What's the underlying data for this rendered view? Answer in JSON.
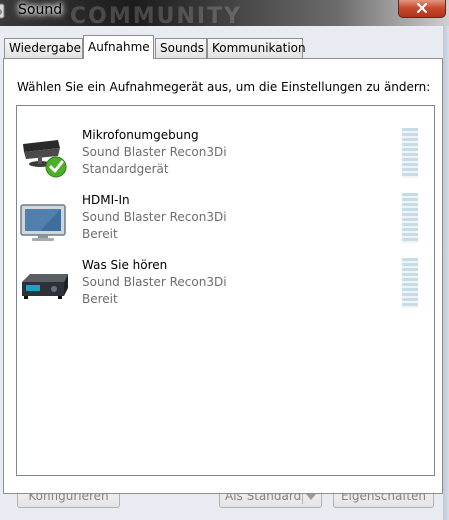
{
  "window": {
    "title": "Sound",
    "title_bar_background_text": "COMMUNITY"
  },
  "tabs": [
    {
      "label": "Wiedergabe",
      "active": false
    },
    {
      "label": "Aufnahme",
      "active": true
    },
    {
      "label": "Sounds",
      "active": false
    },
    {
      "label": "Kommunikation",
      "active": false
    }
  ],
  "panel": {
    "instruction": "Wählen Sie ein Aufnahmegerät aus, um die Einstellungen zu ändern:"
  },
  "devices": [
    {
      "name": "Mikrofonumgebung",
      "driver": "Sound Blaster Recon3Di",
      "status": "Standardgerät",
      "icon": "microphone-icon",
      "default": true
    },
    {
      "name": "HDMI-In",
      "driver": "Sound Blaster Recon3Di",
      "status": "Bereit",
      "icon": "monitor-icon",
      "default": false
    },
    {
      "name": "Was Sie hören",
      "driver": "Sound Blaster Recon3Di",
      "status": "Bereit",
      "icon": "receiver-icon",
      "default": false
    }
  ],
  "buttons": {
    "configure": "Konfigurieren",
    "set_default": "Als Standard",
    "properties": "Eigenschaften"
  },
  "colors": {
    "close_button": "#c74a2c",
    "default_check": "#4caf2a",
    "meter": "#c7dde6",
    "disabled_text": "#838383"
  }
}
